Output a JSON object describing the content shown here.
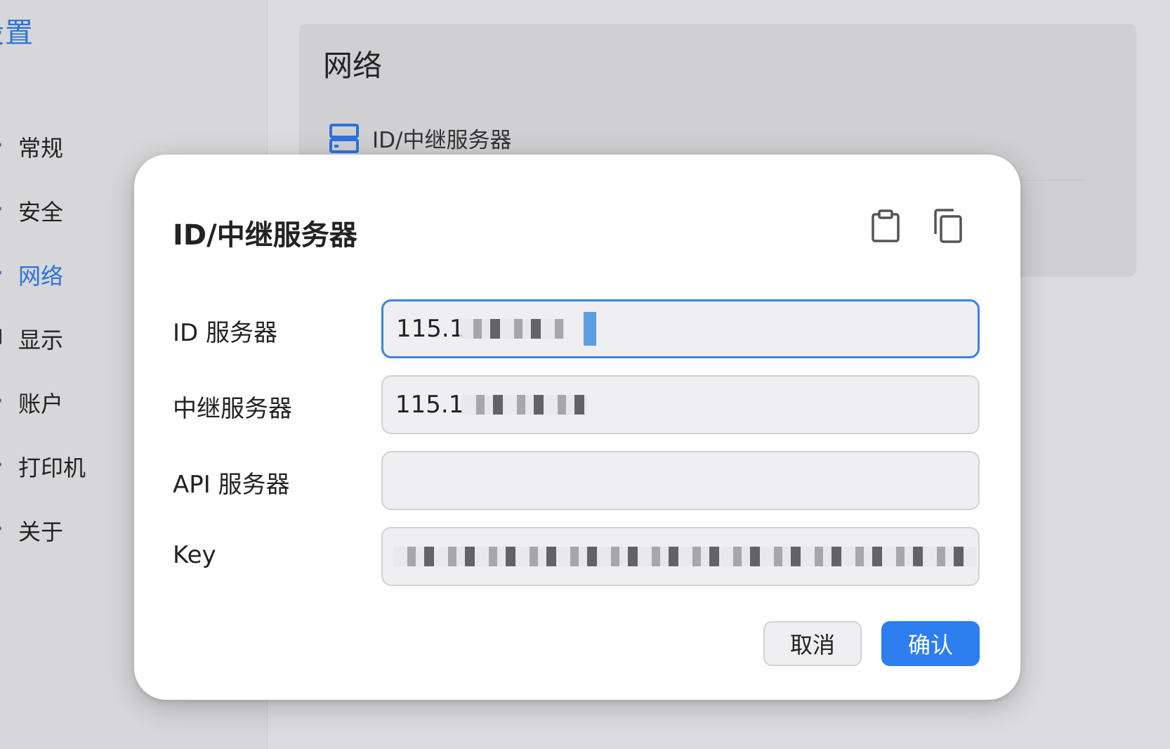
{
  "sidebar": {
    "title": "设置",
    "items": [
      {
        "label": "常规"
      },
      {
        "label": "安全"
      },
      {
        "label": "网络"
      },
      {
        "label": "显示"
      },
      {
        "label": "账户"
      },
      {
        "label": "打印机"
      },
      {
        "label": "关于"
      }
    ]
  },
  "main": {
    "section_title": "网络",
    "server_item_label": "ID/中继服务器"
  },
  "dialog": {
    "title": "ID/中继服务器",
    "fields": [
      {
        "label": "ID 服务器",
        "value": "115.1"
      },
      {
        "label": "中继服务器",
        "value": "115.1"
      },
      {
        "label": "API 服务器",
        "value": ""
      },
      {
        "label": "Key",
        "value": ""
      }
    ],
    "cancel_label": "取消",
    "ok_label": "确认",
    "icons": [
      "clipboard-icon",
      "copy-icon",
      "server-icon"
    ]
  },
  "colors": {
    "accent": "#2d73d9",
    "primary_button": "#2d7ff0",
    "focus_border": "#3b84e0"
  }
}
